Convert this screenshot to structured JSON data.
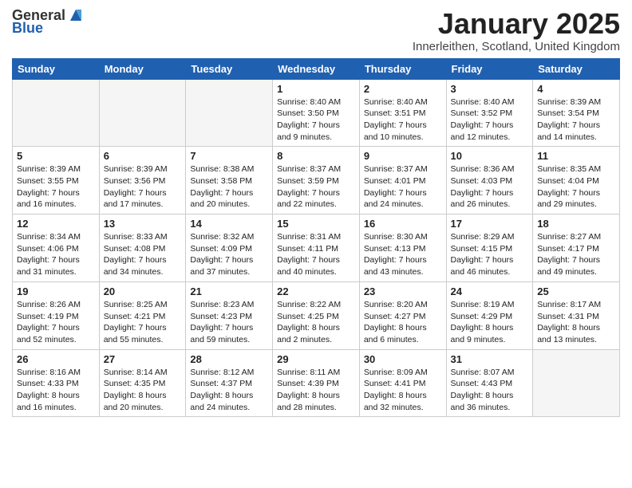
{
  "logo": {
    "text_general": "General",
    "text_blue": "Blue"
  },
  "header": {
    "title": "January 2025",
    "subtitle": "Innerleithen, Scotland, United Kingdom"
  },
  "days_of_week": [
    "Sunday",
    "Monday",
    "Tuesday",
    "Wednesday",
    "Thursday",
    "Friday",
    "Saturday"
  ],
  "weeks": [
    [
      {
        "day": "",
        "info": ""
      },
      {
        "day": "",
        "info": ""
      },
      {
        "day": "",
        "info": ""
      },
      {
        "day": "1",
        "info": "Sunrise: 8:40 AM\nSunset: 3:50 PM\nDaylight: 7 hours and 9 minutes."
      },
      {
        "day": "2",
        "info": "Sunrise: 8:40 AM\nSunset: 3:51 PM\nDaylight: 7 hours and 10 minutes."
      },
      {
        "day": "3",
        "info": "Sunrise: 8:40 AM\nSunset: 3:52 PM\nDaylight: 7 hours and 12 minutes."
      },
      {
        "day": "4",
        "info": "Sunrise: 8:39 AM\nSunset: 3:54 PM\nDaylight: 7 hours and 14 minutes."
      }
    ],
    [
      {
        "day": "5",
        "info": "Sunrise: 8:39 AM\nSunset: 3:55 PM\nDaylight: 7 hours and 16 minutes."
      },
      {
        "day": "6",
        "info": "Sunrise: 8:39 AM\nSunset: 3:56 PM\nDaylight: 7 hours and 17 minutes."
      },
      {
        "day": "7",
        "info": "Sunrise: 8:38 AM\nSunset: 3:58 PM\nDaylight: 7 hours and 20 minutes."
      },
      {
        "day": "8",
        "info": "Sunrise: 8:37 AM\nSunset: 3:59 PM\nDaylight: 7 hours and 22 minutes."
      },
      {
        "day": "9",
        "info": "Sunrise: 8:37 AM\nSunset: 4:01 PM\nDaylight: 7 hours and 24 minutes."
      },
      {
        "day": "10",
        "info": "Sunrise: 8:36 AM\nSunset: 4:03 PM\nDaylight: 7 hours and 26 minutes."
      },
      {
        "day": "11",
        "info": "Sunrise: 8:35 AM\nSunset: 4:04 PM\nDaylight: 7 hours and 29 minutes."
      }
    ],
    [
      {
        "day": "12",
        "info": "Sunrise: 8:34 AM\nSunset: 4:06 PM\nDaylight: 7 hours and 31 minutes."
      },
      {
        "day": "13",
        "info": "Sunrise: 8:33 AM\nSunset: 4:08 PM\nDaylight: 7 hours and 34 minutes."
      },
      {
        "day": "14",
        "info": "Sunrise: 8:32 AM\nSunset: 4:09 PM\nDaylight: 7 hours and 37 minutes."
      },
      {
        "day": "15",
        "info": "Sunrise: 8:31 AM\nSunset: 4:11 PM\nDaylight: 7 hours and 40 minutes."
      },
      {
        "day": "16",
        "info": "Sunrise: 8:30 AM\nSunset: 4:13 PM\nDaylight: 7 hours and 43 minutes."
      },
      {
        "day": "17",
        "info": "Sunrise: 8:29 AM\nSunset: 4:15 PM\nDaylight: 7 hours and 46 minutes."
      },
      {
        "day": "18",
        "info": "Sunrise: 8:27 AM\nSunset: 4:17 PM\nDaylight: 7 hours and 49 minutes."
      }
    ],
    [
      {
        "day": "19",
        "info": "Sunrise: 8:26 AM\nSunset: 4:19 PM\nDaylight: 7 hours and 52 minutes."
      },
      {
        "day": "20",
        "info": "Sunrise: 8:25 AM\nSunset: 4:21 PM\nDaylight: 7 hours and 55 minutes."
      },
      {
        "day": "21",
        "info": "Sunrise: 8:23 AM\nSunset: 4:23 PM\nDaylight: 7 hours and 59 minutes."
      },
      {
        "day": "22",
        "info": "Sunrise: 8:22 AM\nSunset: 4:25 PM\nDaylight: 8 hours and 2 minutes."
      },
      {
        "day": "23",
        "info": "Sunrise: 8:20 AM\nSunset: 4:27 PM\nDaylight: 8 hours and 6 minutes."
      },
      {
        "day": "24",
        "info": "Sunrise: 8:19 AM\nSunset: 4:29 PM\nDaylight: 8 hours and 9 minutes."
      },
      {
        "day": "25",
        "info": "Sunrise: 8:17 AM\nSunset: 4:31 PM\nDaylight: 8 hours and 13 minutes."
      }
    ],
    [
      {
        "day": "26",
        "info": "Sunrise: 8:16 AM\nSunset: 4:33 PM\nDaylight: 8 hours and 16 minutes."
      },
      {
        "day": "27",
        "info": "Sunrise: 8:14 AM\nSunset: 4:35 PM\nDaylight: 8 hours and 20 minutes."
      },
      {
        "day": "28",
        "info": "Sunrise: 8:12 AM\nSunset: 4:37 PM\nDaylight: 8 hours and 24 minutes."
      },
      {
        "day": "29",
        "info": "Sunrise: 8:11 AM\nSunset: 4:39 PM\nDaylight: 8 hours and 28 minutes."
      },
      {
        "day": "30",
        "info": "Sunrise: 8:09 AM\nSunset: 4:41 PM\nDaylight: 8 hours and 32 minutes."
      },
      {
        "day": "31",
        "info": "Sunrise: 8:07 AM\nSunset: 4:43 PM\nDaylight: 8 hours and 36 minutes."
      },
      {
        "day": "",
        "info": ""
      }
    ]
  ]
}
